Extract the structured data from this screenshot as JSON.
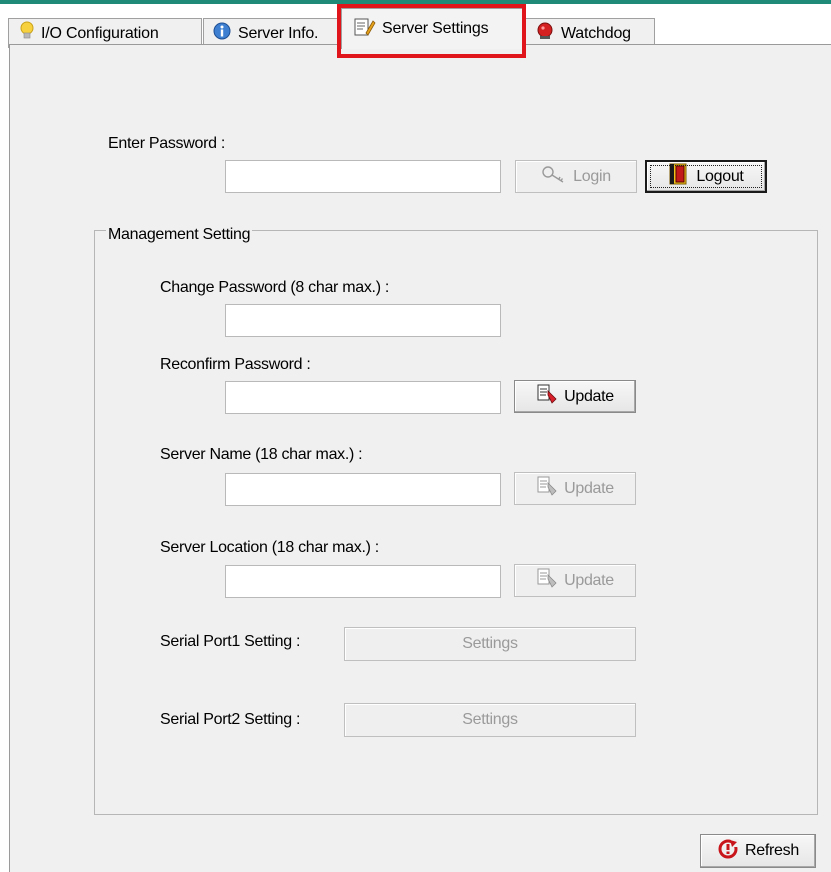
{
  "tabs": [
    {
      "label": "I/O Configuration",
      "icon": "lightbulb-icon"
    },
    {
      "label": "Server Info.",
      "icon": "info-icon"
    },
    {
      "label": "Server Settings",
      "icon": "settings-tool-icon",
      "active": true
    },
    {
      "label": "Watchdog",
      "icon": "watchdog-icon"
    }
  ],
  "login": {
    "label": "Enter Password :",
    "password_value": "",
    "login_button": "Login",
    "logout_button": "Logout"
  },
  "management": {
    "title": "Management Setting",
    "change_password": {
      "label": "Change Password (8 char max.) :",
      "value": ""
    },
    "reconfirm_password": {
      "label": "Reconfirm Password :",
      "value": "",
      "button": "Update"
    },
    "server_name": {
      "label": "Server Name (18 char max.) :",
      "value": "",
      "button": "Update"
    },
    "server_location": {
      "label": "Server Location (18 char max.) :",
      "value": "",
      "button": "Update"
    },
    "serial_port1": {
      "label": "Serial Port1 Setting :",
      "button": "Settings"
    },
    "serial_port2": {
      "label": "Serial Port2 Setting :",
      "button": "Settings"
    }
  },
  "refresh_button": "Refresh",
  "colors": {
    "highlight": "#e0151b",
    "accent_strip": "#1e8a77"
  }
}
